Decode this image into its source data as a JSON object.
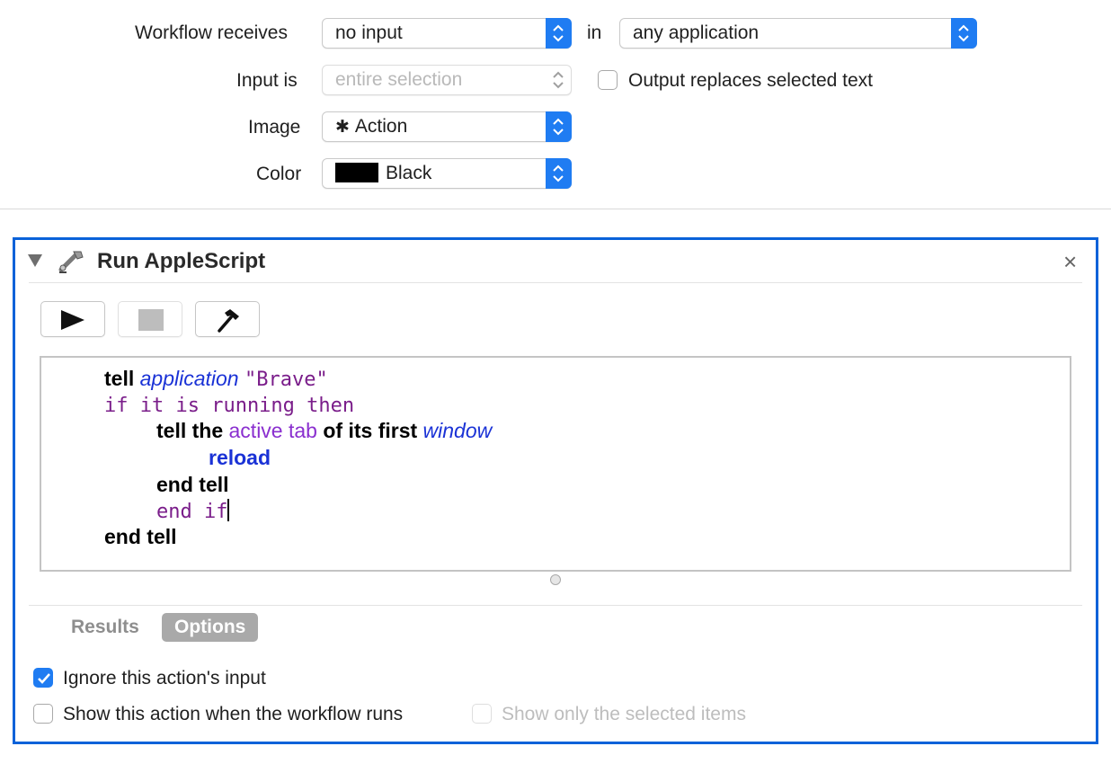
{
  "config": {
    "workflow_receives_label": "Workflow receives",
    "workflow_receives_value": "no input",
    "in_label": "in",
    "application_value": "any application",
    "input_is_label": "Input is",
    "input_is_value": "entire selection",
    "output_replaces_label": "Output replaces selected text",
    "image_label": "Image",
    "image_value": "Action",
    "color_label": "Color",
    "color_value": "Black",
    "color_swatch": "#000000"
  },
  "action": {
    "title": "Run AppleScript",
    "close_glyph": "×"
  },
  "script": {
    "l1_kw": "tell",
    "l1_cls": "application",
    "l1_str": "\"Brave\"",
    "l2": "if it is running then",
    "l3_kw1": "tell the",
    "l3_prop": "active tab",
    "l3_kw2": "of its first",
    "l3_cls": "window",
    "l4": "reload",
    "l5": "end tell",
    "l6": "end if",
    "l7": "end tell"
  },
  "tabs": {
    "results": "Results",
    "options": "Options"
  },
  "options": {
    "ignore_input_label": "Ignore this action's input",
    "show_action_label": "Show this action when the workflow runs",
    "show_selected_label": "Show only the selected items"
  },
  "colors": {
    "accent": "#1f7cf2",
    "selection_border": "#0a62d9"
  }
}
